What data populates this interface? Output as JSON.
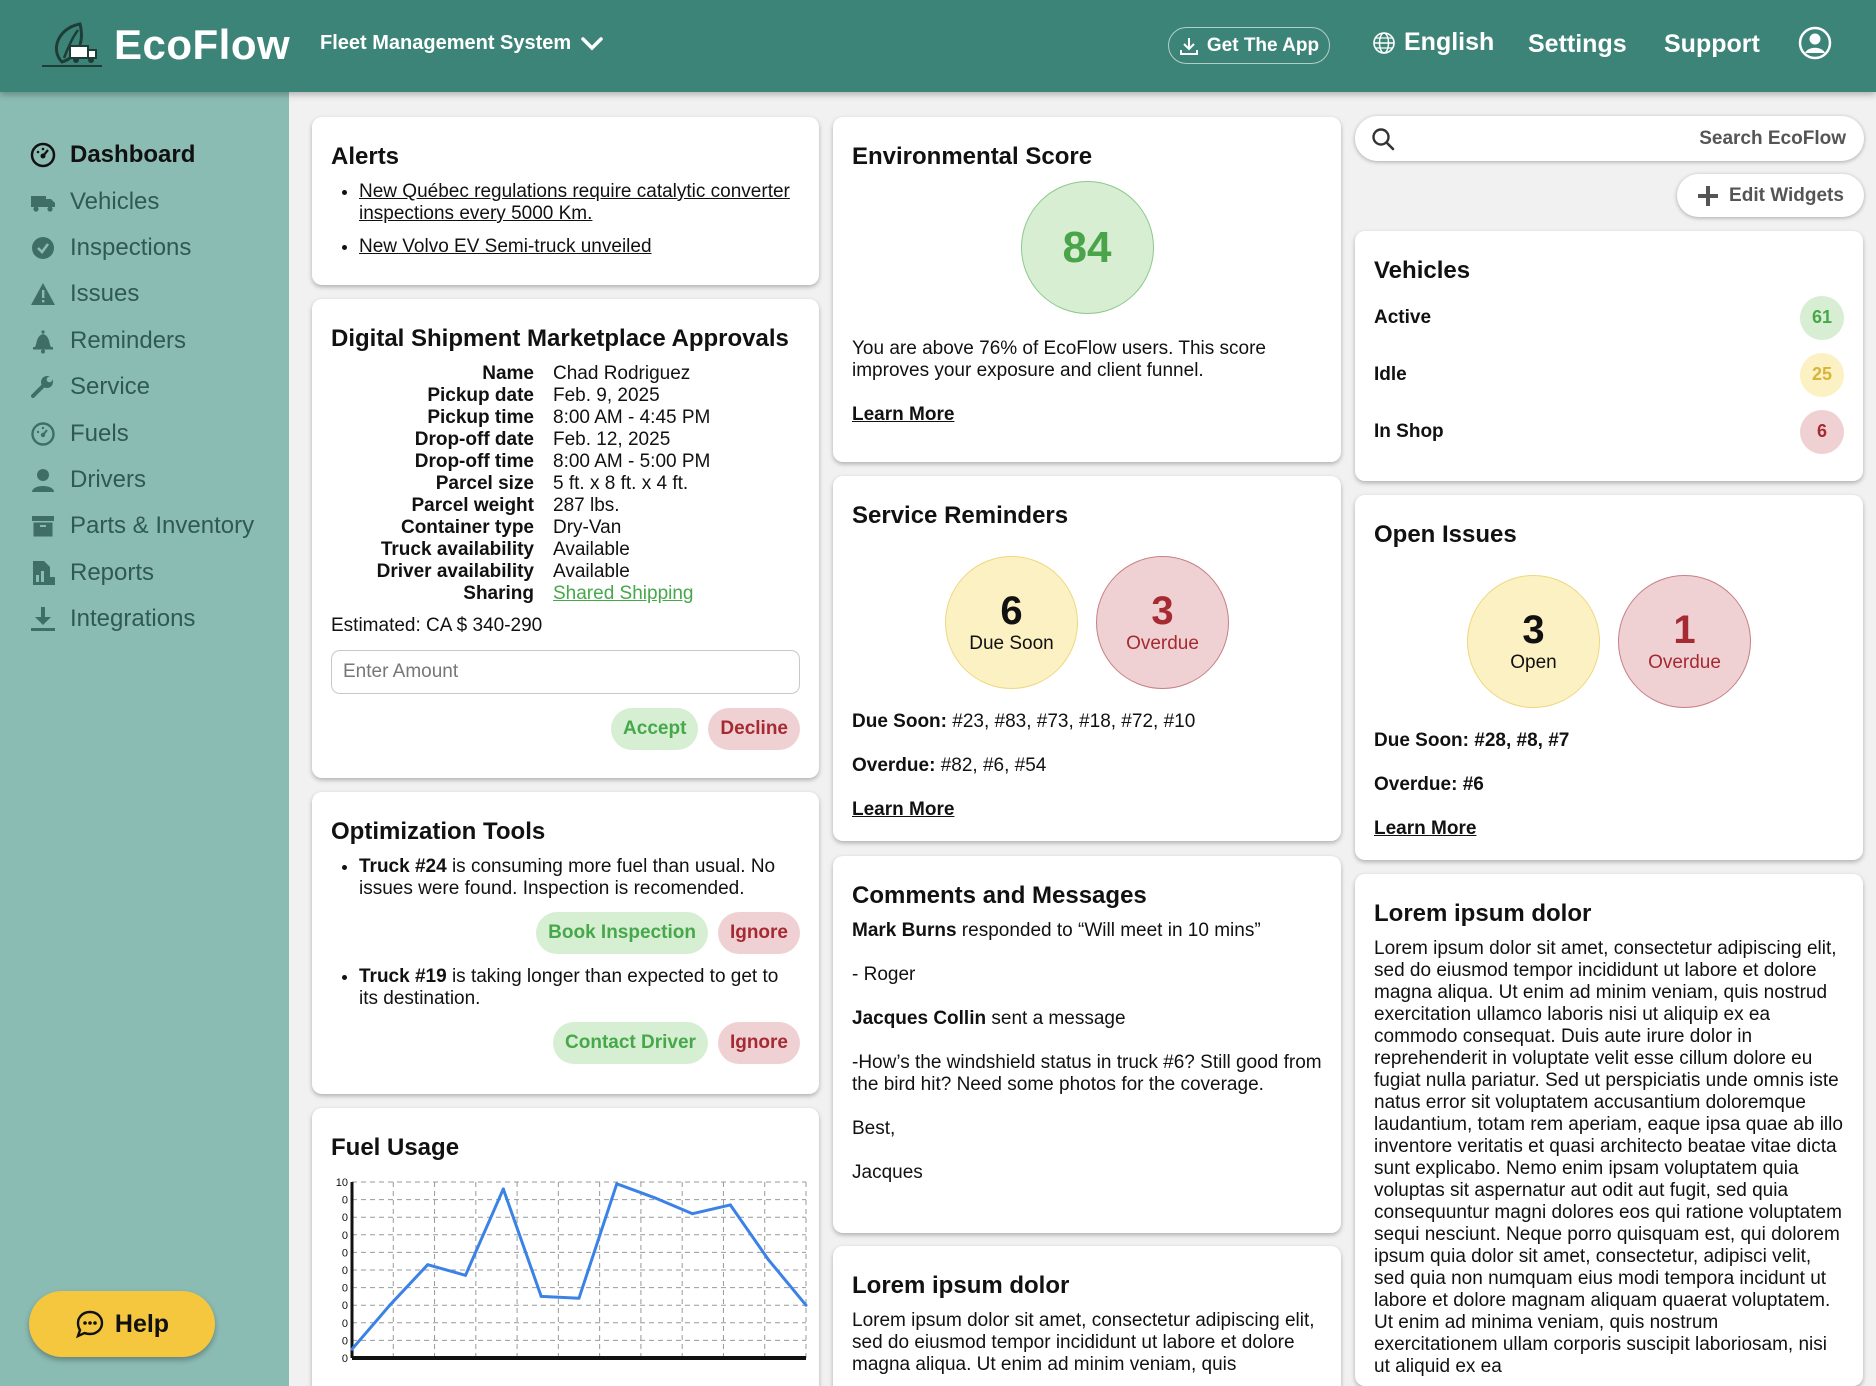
{
  "header": {
    "brand": "EcoFlow",
    "system_menu": "Fleet Management System",
    "get_app": "Get The App",
    "language": "English",
    "settings": "Settings",
    "support": "Support"
  },
  "sidebar": {
    "items": [
      {
        "label": "Dashboard",
        "icon": "dashboard-icon"
      },
      {
        "label": "Vehicles",
        "icon": "truck-icon"
      },
      {
        "label": "Inspections",
        "icon": "check-circle-icon"
      },
      {
        "label": "Issues",
        "icon": "warning-icon"
      },
      {
        "label": "Reminders",
        "icon": "bell-icon"
      },
      {
        "label": "Service",
        "icon": "wrench-icon"
      },
      {
        "label": "Fuels",
        "icon": "gauge-icon"
      },
      {
        "label": "Drivers",
        "icon": "person-icon"
      },
      {
        "label": "Parts & Inventory",
        "icon": "box-icon"
      },
      {
        "label": "Reports",
        "icon": "report-icon"
      },
      {
        "label": "Integrations",
        "icon": "download-icon"
      }
    ],
    "help": "Help"
  },
  "alerts": {
    "title": "Alerts",
    "items": [
      "New Québec regulations require catalytic converter inspections every 5000 Km.",
      "New Volvo EV Semi-truck unveiled"
    ]
  },
  "shipment": {
    "title": "Digital Shipment Marketplace Approvals",
    "rows": [
      {
        "k": "Name",
        "v": "Chad Rodriguez"
      },
      {
        "k": "Pickup date",
        "v": "Feb. 9, 2025"
      },
      {
        "k": "Pickup time",
        "v": "8:00 AM - 4:45 PM"
      },
      {
        "k": "Drop-off date",
        "v": "Feb. 12, 2025"
      },
      {
        "k": "Drop-off time",
        "v": "8:00 AM - 5:00 PM"
      },
      {
        "k": "Parcel size",
        "v": "5 ft. x 8 ft. x 4 ft."
      },
      {
        "k": "Parcel weight",
        "v": "287 lbs."
      },
      {
        "k": "Container type",
        "v": "Dry-Van"
      },
      {
        "k": "Truck availability",
        "v": "Available"
      },
      {
        "k": "Driver availability",
        "v": "Available"
      },
      {
        "k": "Sharing",
        "v": "Shared Shipping"
      }
    ],
    "estimated": "Estimated: CA $ 340-290",
    "amount_placeholder": "Enter Amount",
    "accept": "Accept",
    "decline": "Decline"
  },
  "optimization": {
    "title": "Optimization Tools",
    "items": [
      {
        "bold": "Truck #24",
        "text": " is consuming more fuel than usual. No issues were found. Inspection is recomended.",
        "primary": "Book Inspection",
        "secondary": "Ignore"
      },
      {
        "bold": "Truck #19",
        "text": " is taking longer than expected to get to its destination.",
        "primary": "Contact Driver",
        "secondary": "Ignore"
      }
    ]
  },
  "fuel": {
    "title": "Fuel Usage"
  },
  "chart_data": {
    "type": "line",
    "title": "Fuel Usage",
    "xlabel": "",
    "ylabel": "",
    "x": [
      0,
      1,
      2,
      3,
      4,
      5,
      6,
      7,
      8,
      9,
      10,
      11,
      12
    ],
    "y": [
      0.5,
      3.0,
      5.3,
      4.7,
      9.6,
      3.5,
      3.4,
      9.9,
      9.1,
      8.2,
      8.7,
      5.6,
      3.0
    ],
    "ylim": [
      0,
      10
    ],
    "y_tick_labels": [
      "0",
      "0",
      "0",
      "0",
      "0",
      "0",
      "0",
      "0",
      "0",
      "0",
      "10"
    ],
    "grid": true,
    "line_color": "#3b82e6"
  },
  "environmental": {
    "title": "Environmental Score",
    "score": "84",
    "text": "You are above 76% of EcoFlow users. This score improves your exposure and client funnel.",
    "learn_more": "Learn More"
  },
  "service_reminders": {
    "title": "Service Reminders",
    "due_soon_count": "6",
    "due_soon_label": "Due Soon",
    "overdue_count": "3",
    "overdue_label": "Overdue",
    "due_soon_key": "Due Soon:",
    "due_soon_list": " #23, #83, #73, #18, #72, #10",
    "overdue_key": "Overdue:",
    "overdue_list": " #82, #6, #54",
    "learn_more": "Learn More"
  },
  "comments": {
    "title": "Comments and Messages",
    "m1_name": "Mark Burns",
    "m1_text": " responded to “Will meet in 10 mins”",
    "m1_sign": "- Roger",
    "m2_name": "Jacques Collin",
    "m2_text": " sent a message",
    "m2_body": "-How’s the windshield status in truck #6? Still good from the bird hit? Need some photos for the coverage.",
    "m2_closing": "Best,",
    "m2_sign": "Jacques"
  },
  "lorem_mid": {
    "title": "Lorem ipsum dolor",
    "text": "Lorem ipsum dolor sit amet, consectetur adipiscing elit, sed do eiusmod tempor incididunt ut labore et dolore magna aliqua. Ut enim ad minim veniam, quis"
  },
  "search": {
    "placeholder": "Search EcoFlow"
  },
  "edit_widgets": "Edit Widgets",
  "vehicles": {
    "title": "Vehicles",
    "rows": [
      {
        "label": "Active",
        "count": "61",
        "color": "#46a84a"
      },
      {
        "label": "Idle",
        "count": "25",
        "color": "#d9b43a"
      },
      {
        "label": "In Shop",
        "count": "6",
        "color": "#a62a32"
      }
    ]
  },
  "open_issues": {
    "title": "Open Issues",
    "open_count": "3",
    "open_label": "Open",
    "overdue_count": "1",
    "overdue_label": "Overdue",
    "due_soon_text": "Due Soon: #28, #8, #7",
    "overdue_text": "Overdue: #6",
    "learn_more": "Learn More"
  },
  "lorem_right": {
    "title": "Lorem ipsum dolor",
    "text": "Lorem ipsum dolor sit amet, consectetur adipiscing elit, sed do eiusmod tempor incididunt ut labore et dolore magna aliqua. Ut enim ad minim veniam, quis nostrud exercitation ullamco laboris nisi ut aliquip ex ea commodo consequat. Duis aute irure dolor in reprehenderit in voluptate velit esse cillum dolore eu fugiat nulla pariatur. Sed ut perspiciatis unde omnis iste natus error sit voluptatem accusantium doloremque laudantium, totam rem aperiam, eaque ipsa quae ab illo inventore veritatis et quasi architecto beatae vitae dicta sunt explicabo. Nemo enim ipsam voluptatem quia voluptas sit aspernatur aut odit aut fugit, sed quia consequuntur magni dolores eos qui ratione voluptatem sequi nesciunt. Neque porro quisquam est, qui dolorem ipsum quia dolor sit amet, consectetur, adipisci velit, sed quia non numquam eius modi tempora incidunt ut labore et dolore magnam aliquam quaerat voluptatem. Ut enim ad minima veniam, quis nostrum exercitationem ullam corporis suscipit laboriosam, nisi ut aliquid ex ea"
  }
}
